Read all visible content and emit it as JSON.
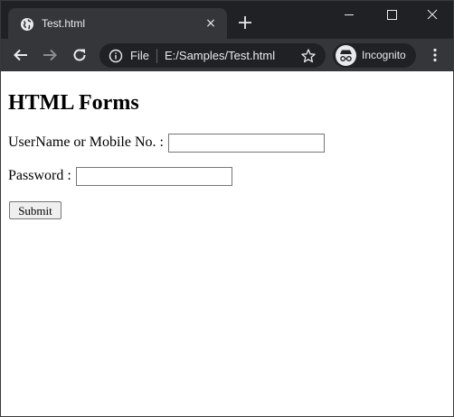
{
  "browser": {
    "tab": {
      "title": "Test.html",
      "favicon": "globe-icon",
      "close": "×"
    },
    "new_tab_icon": "plus-icon",
    "window_controls": [
      "minimize-icon",
      "maximize-icon",
      "close-icon"
    ],
    "toolbar": {
      "scheme": "File",
      "url": "E:/Samples/Test.html",
      "profile_label": "Incognito"
    },
    "colors": {
      "frame": "#202124",
      "toolbar": "#35363a",
      "text": "#e8eaed"
    }
  },
  "page": {
    "heading": "HTML Forms",
    "username_label": "UserName or Mobile No. :",
    "username_value": "",
    "password_label": "Password :",
    "password_value": "",
    "submit_label": "Submit"
  }
}
